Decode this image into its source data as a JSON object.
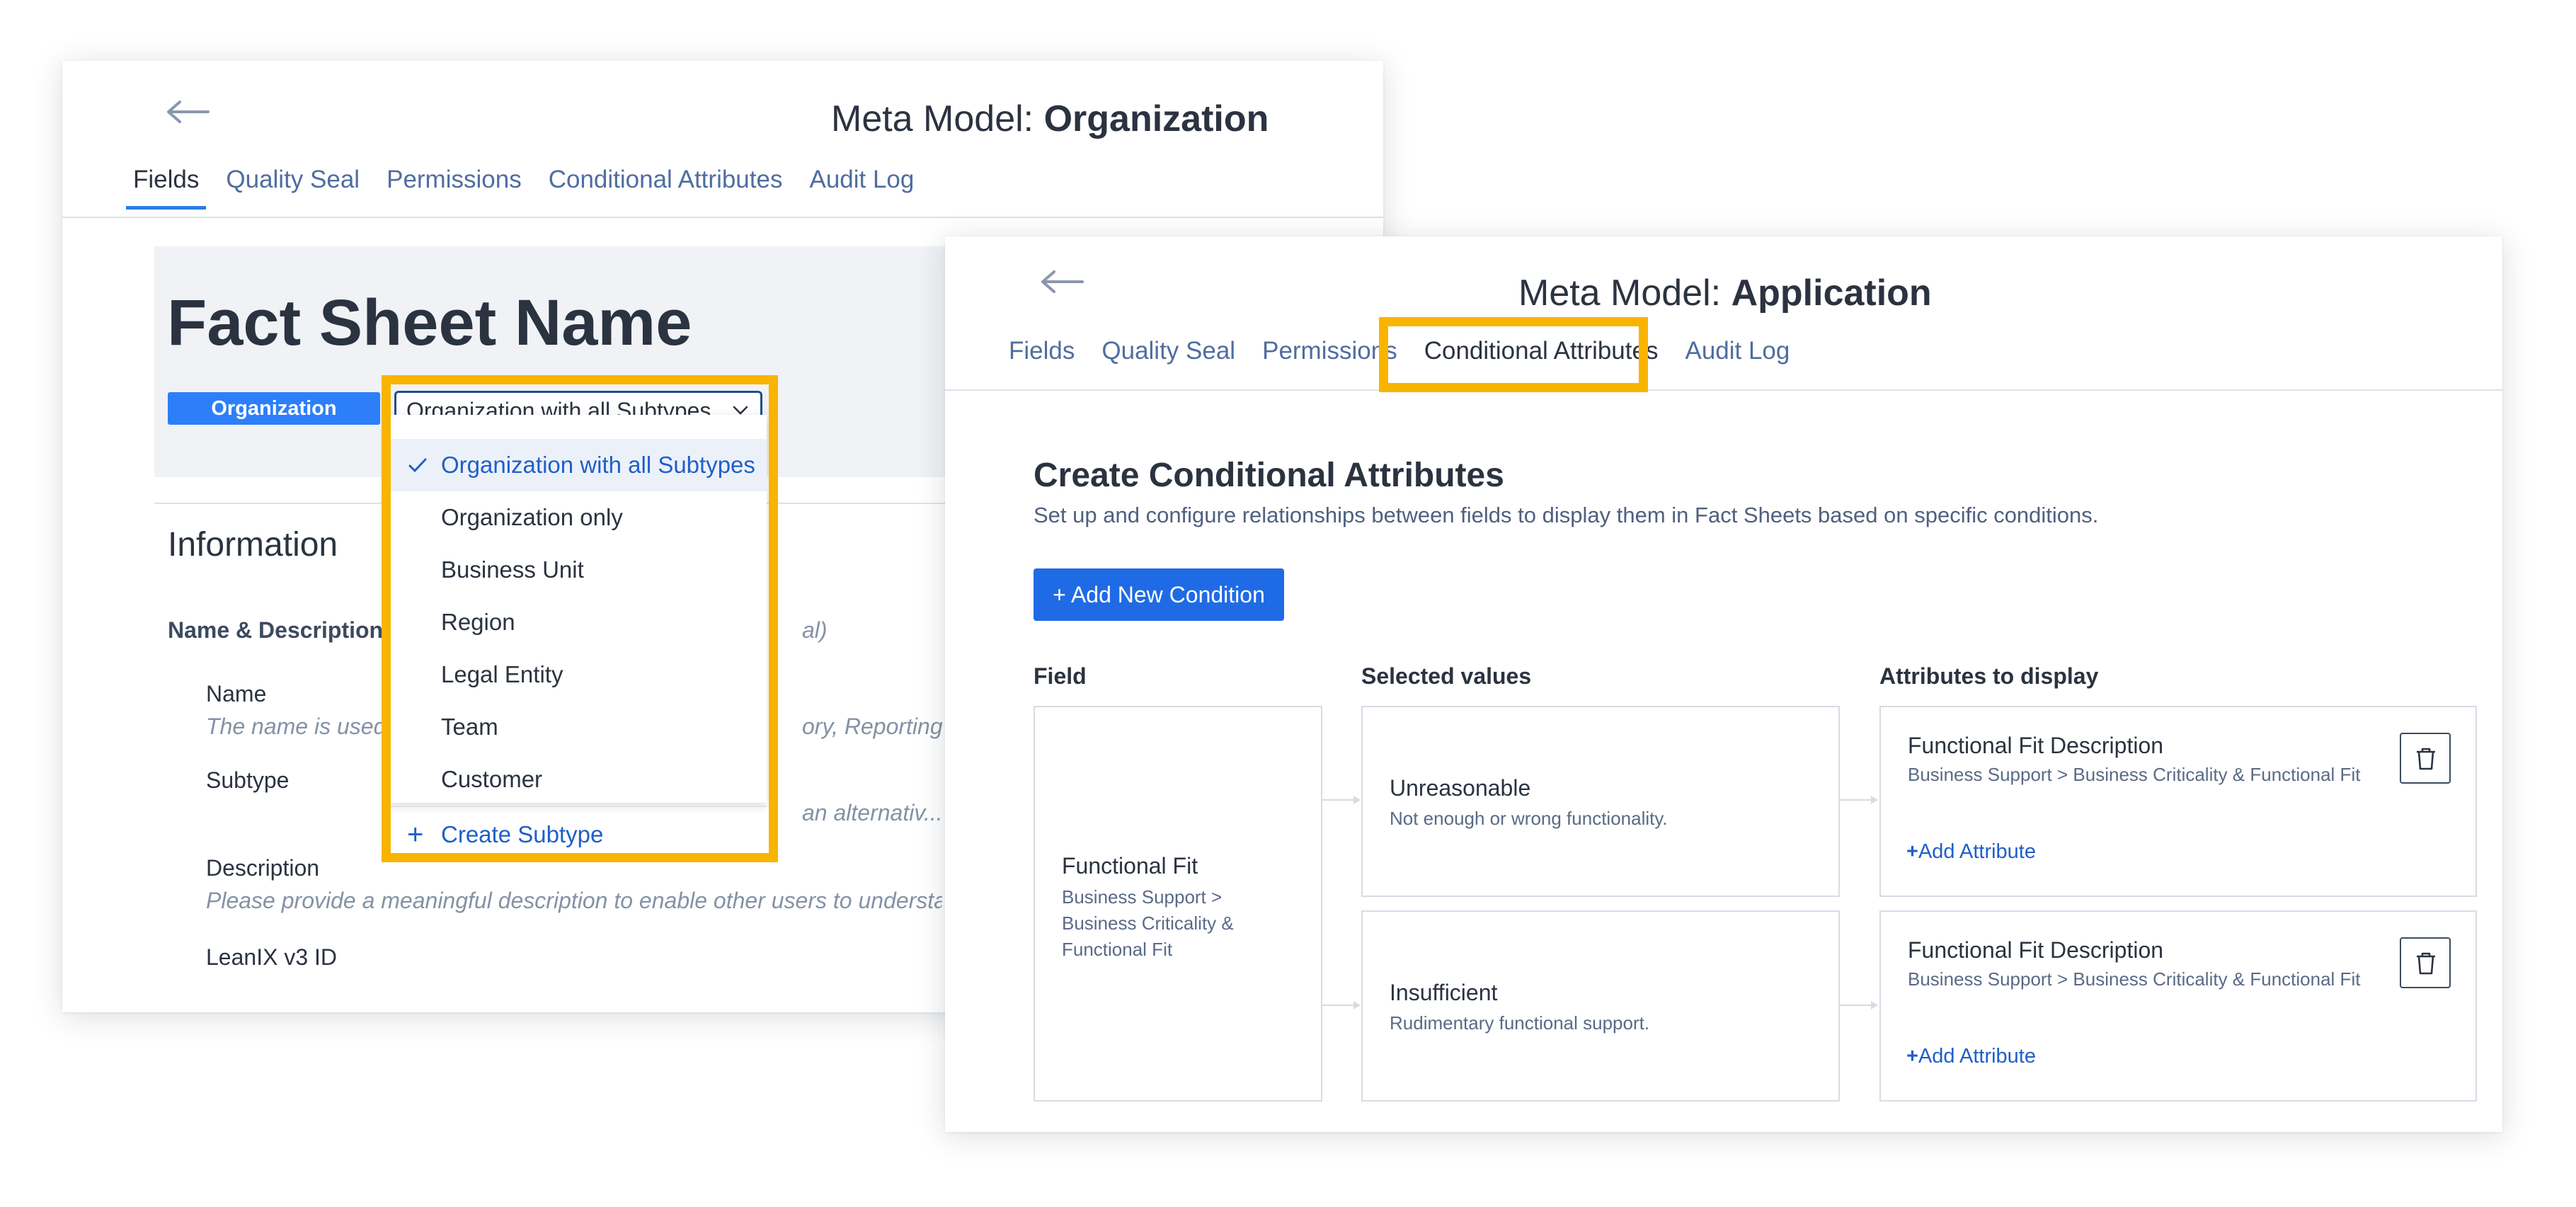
{
  "org_window": {
    "title_prefix": "Meta Model:",
    "title_bold": "Organization",
    "tabs": [
      "Fields",
      "Quality Seal",
      "Permissions",
      "Conditional Attributes",
      "Audit Log"
    ],
    "active_tab": "Fields",
    "fact_sheet_name": "Fact Sheet Name",
    "badge": "Organization",
    "subtype_select": "Organization with all Subtypes",
    "dropdown": {
      "selected": "Organization with all Subtypes",
      "options": [
        "Organization only",
        "Business Unit",
        "Region",
        "Legal Entity",
        "Team",
        "Customer"
      ],
      "create": "Create Subtype"
    },
    "info_title": "Information",
    "section_label": "Name & Description",
    "section_hint": "al)",
    "fields": [
      {
        "label": "Name",
        "help": "The name is used",
        "help_tail": "ory, Reporting ar"
      },
      {
        "label": "Subtype",
        "help": "",
        "help_tail": "an alternativ..."
      },
      {
        "label": "Description",
        "help": "Please provide a meaningful description to enable other users to understa",
        "help_tail": ""
      },
      {
        "label": "LeanIX v3 ID",
        "help": "",
        "help_tail": ""
      }
    ]
  },
  "app_window": {
    "title_prefix": "Meta Model:",
    "title_bold": "Application",
    "tabs": [
      "Fields",
      "Quality Seal",
      "Permissions",
      "Conditional Attributes",
      "Audit Log"
    ],
    "active_tab": "Conditional Attributes",
    "heading": "Create Conditional Attributes",
    "subheading": "Set up and configure relationships between fields to display them in Fact Sheets based on specific conditions.",
    "add_button": "+ Add New Condition",
    "columns": [
      "Field",
      "Selected values",
      "Attributes to display"
    ],
    "field_card": {
      "title": "Functional Fit",
      "path": "Business Support > Business Criticality & Functional Fit"
    },
    "values": [
      {
        "title": "Unreasonable",
        "desc": "Not enough or wrong functionality."
      },
      {
        "title": "Insufficient",
        "desc": "Rudimentary functional support."
      }
    ],
    "attributes": [
      {
        "title": "Functional Fit Description",
        "path": "Business Support > Business Criticality & Functional Fit",
        "add_label": "Add Attribute"
      },
      {
        "title": "Functional Fit Description",
        "path": "Business Support > Business Criticality & Functional Fit",
        "add_label": "Add Attribute"
      }
    ]
  },
  "colors": {
    "highlight": "#f8b400",
    "primary": "#1f6be5",
    "badge": "#2d7ff9",
    "link": "#1f5fc9"
  }
}
